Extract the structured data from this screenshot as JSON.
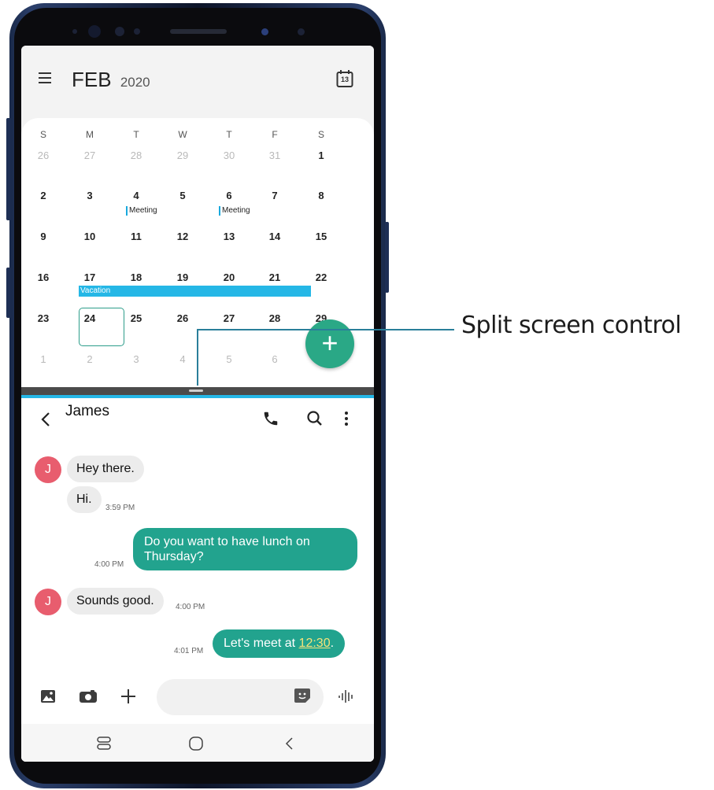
{
  "callout": {
    "label": "Split screen control"
  },
  "calendar": {
    "month": "FEB",
    "year": "2020",
    "today_icon_label": "13",
    "weekdays": [
      "S",
      "M",
      "T",
      "W",
      "T",
      "F",
      "S"
    ],
    "weeks": [
      [
        "26",
        "27",
        "28",
        "29",
        "30",
        "31",
        "1"
      ],
      [
        "2",
        "3",
        "4",
        "5",
        "6",
        "7",
        "8"
      ],
      [
        "9",
        "10",
        "11",
        "12",
        "13",
        "14",
        "15"
      ],
      [
        "16",
        "17",
        "18",
        "19",
        "20",
        "21",
        "22"
      ],
      [
        "23",
        "24",
        "25",
        "26",
        "27",
        "28",
        "29"
      ],
      [
        "1",
        "2",
        "3",
        "4",
        "5",
        "6",
        ""
      ]
    ],
    "events": {
      "meeting_1": "Meeting",
      "meeting_2": "Meeting",
      "vacation": "Vacation"
    },
    "fab_label": "+",
    "accent": "#25b7e6",
    "fab_color": "#2aa886"
  },
  "messages": {
    "contact": "James",
    "avatar_letter": "J",
    "thread": [
      {
        "from": "in",
        "text": "Hey there."
      },
      {
        "from": "in",
        "text": "Hi.",
        "time": "3:59 PM"
      },
      {
        "from": "out",
        "line1": "Do you want to have lunch on",
        "line2": "Thursday?",
        "time": "4:00 PM"
      },
      {
        "from": "in",
        "text": "Sounds good.",
        "time": "4:00 PM"
      },
      {
        "from": "out",
        "prefix": "Let's meet at ",
        "link": "12:30",
        "suffix": ".",
        "time": "4:01 PM"
      }
    ],
    "bubble_out_color": "#22a38e",
    "avatar_color": "#e85d6e"
  }
}
